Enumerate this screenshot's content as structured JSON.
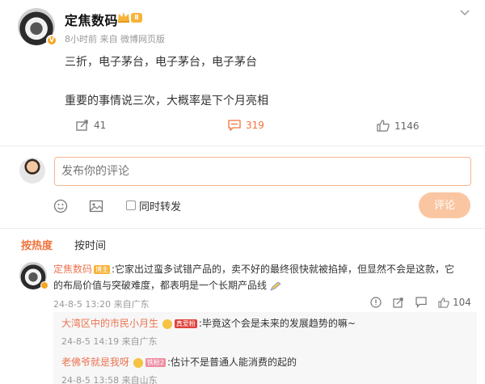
{
  "post": {
    "author": "定焦数码",
    "level": "Ⅱ",
    "meta": "8小时前  来自 微博网页版",
    "line1": "三折，电子茅台，电子茅台，电子茅台",
    "line2": "重要的事情说三次，大概率是下个月亮相",
    "reposts": "41",
    "comments": "319",
    "likes": "1146"
  },
  "composer": {
    "placeholder": "发布你的评论",
    "repost_label": "同时转发",
    "submit_label": "评论"
  },
  "sort_tabs": {
    "hot": "按热度",
    "time": "按时间"
  },
  "comment": {
    "author": "定焦数码",
    "author_tag": "博主",
    "text_line1": ":它家出过蛮多试错产品的，卖不好的最终很快就被掐掉，但显然不会是这款，它",
    "text_line2": "的布局价值与突破难度，都表明是一个长期产品线",
    "meta": "24-8-5 13:20  来自广东",
    "likes": "104"
  },
  "replies": [
    {
      "author": "大湾区中的市民小月生",
      "tag": "真爱粉",
      "text": ":毕竟这个会是未来的发展趋势的嘛~",
      "meta": "24-8-5 14:19  来自广东"
    },
    {
      "author": "老佛爷就是我呀",
      "tag": "铁粉2",
      "text": ":估计不是普通人能消费的起的",
      "meta": "24-8-5 13:58  来自山东"
    }
  ],
  "colors": {
    "accent": "#f2733b",
    "name": "#eb7350",
    "button_disabled": "#fac6a2"
  }
}
